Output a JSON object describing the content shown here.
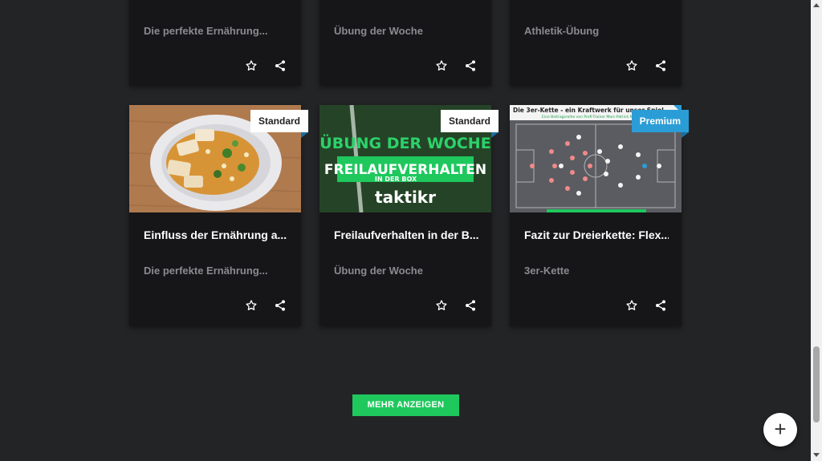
{
  "top_row": [
    {
      "category": "Die perfekte Ernährung..."
    },
    {
      "category": "Übung der Woche"
    },
    {
      "category": "Athletik-Übung"
    }
  ],
  "cards": [
    {
      "badge": "Standard",
      "title": "Einfluss der Ernährung a...",
      "category": "Die perfekte Ernährung..."
    },
    {
      "badge": "Standard",
      "title": "Freilaufverhalten in der B...",
      "category": "Übung der Woche",
      "thumb": {
        "line1": "ÜBUNG DER WOCHE",
        "line2": "FREILAUFVERHALTEN",
        "line3": "IN DER BOX",
        "brand": "taktikr"
      }
    },
    {
      "badge": "Premium",
      "title": "Fazit zur Dreierkette: Flex...",
      "category": "3er-Kette",
      "thumb": {
        "header": "Die 3er-Kette - ein Kraftwerk für unser Spiel",
        "sub": "Eine Beitragsreihe von Profi-Trainer Marc-Patrick Meister"
      }
    }
  ],
  "more_button": "MEHR ANZEIGEN",
  "fab_symbol": "+",
  "icons": {
    "star": "star-outline-icon",
    "share": "share-icon"
  },
  "colors": {
    "accent_green": "#1ec85d",
    "premium_blue": "#2b9dd6",
    "card_bg": "#161619",
    "page_bg": "#232426"
  }
}
